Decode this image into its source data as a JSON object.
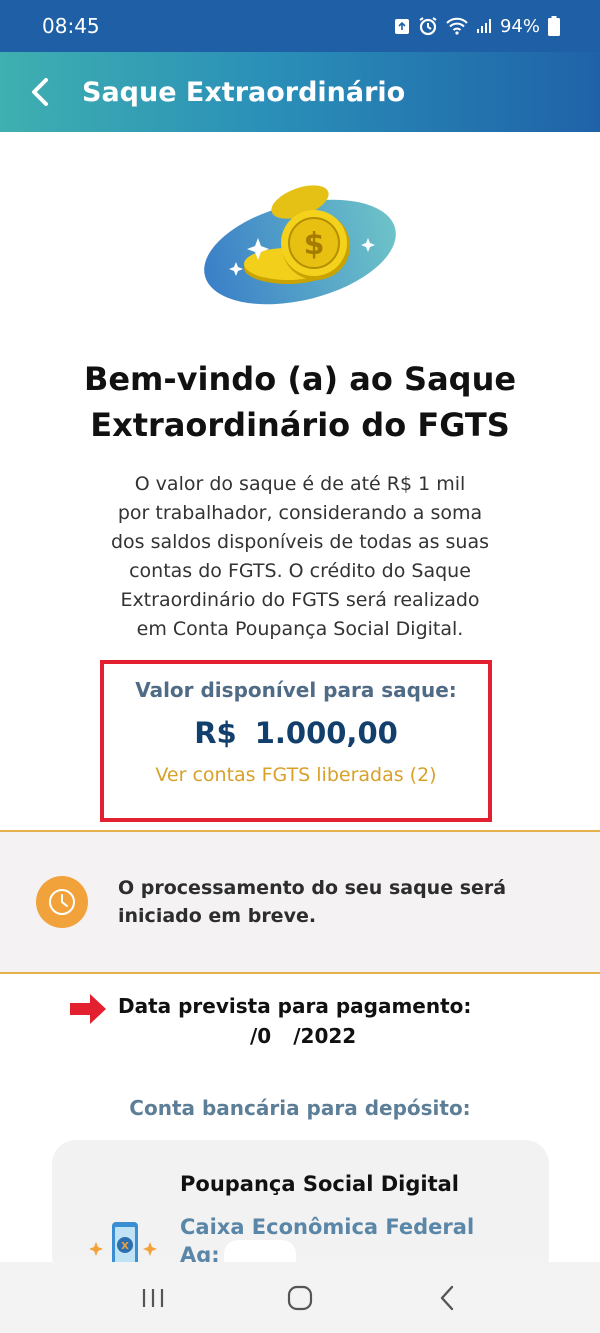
{
  "status_bar": {
    "time": "08:45",
    "battery": "94%"
  },
  "header": {
    "title": "Saque Extraordinário"
  },
  "welcome": {
    "title_line1": "Bem-vindo (a) ao Saque",
    "title_line2": "Extraordinário do FGTS"
  },
  "intro": {
    "lines": [
      "O valor do saque é de até R$ 1 mil",
      "por trabalhador, considerando a soma",
      "dos saldos disponíveis de todas as suas",
      "contas do FGTS. O crédito do Saque",
      "Extraordinário do FGTS será realizado",
      "em Conta Poupança Social Digital."
    ]
  },
  "available": {
    "label": "Valor disponível para saque:",
    "currency": "R$",
    "amount": "1.000,00",
    "link": "Ver contas FGTS liberadas (2)"
  },
  "notice": {
    "text": "O processamento do seu saque será iniciado em breve."
  },
  "payment": {
    "label": "Data prevista para pagamento:",
    "date_mid": "/0",
    "date_end": "/2022"
  },
  "bank": {
    "heading": "Conta bancária para depósito:",
    "account_type": "Poupança Social Digital",
    "institution": "Caixa Econômica Federal",
    "agency_label": "Ag:"
  },
  "colors": {
    "accent": "#1e5fa6",
    "highlight": "#e3202f",
    "gold": "#d7a12a",
    "notice_icon": "#f2a23b"
  }
}
